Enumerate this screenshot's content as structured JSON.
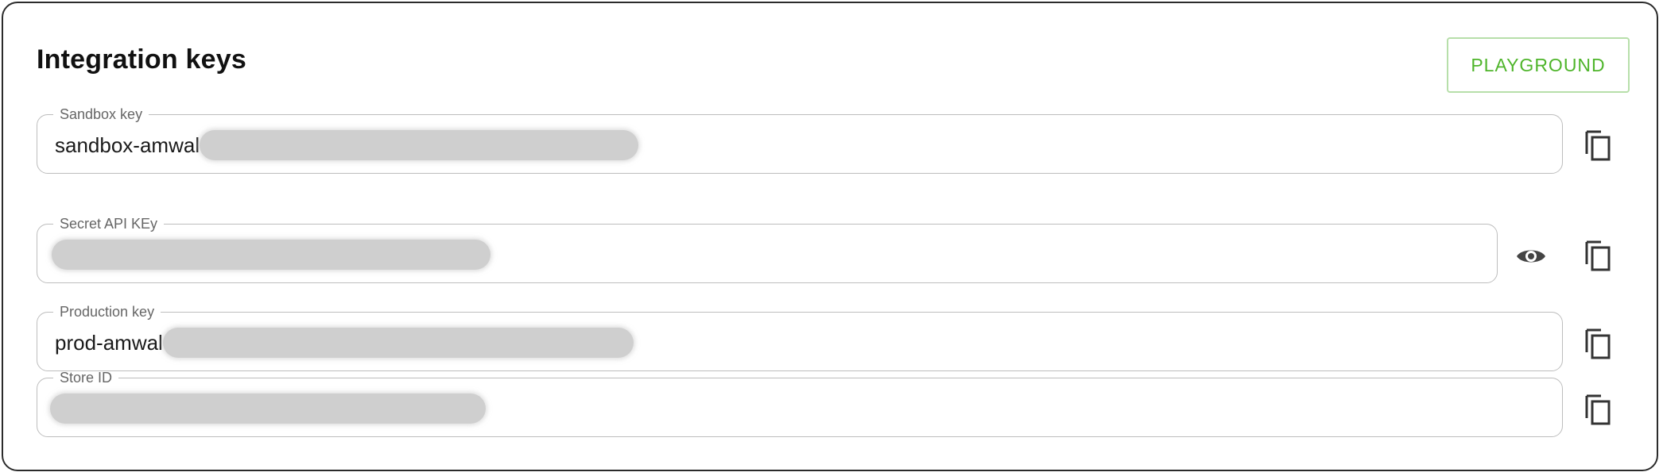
{
  "section": {
    "title": "Integration keys",
    "playground_label": "PLAYGROUND",
    "accent_color": "#4fb52b"
  },
  "fields": {
    "sandbox": {
      "label": "Sandbox key",
      "prefix": "sandbox-amwal",
      "value_masked": true
    },
    "secret": {
      "label": "Secret API KEy",
      "value_masked": true
    },
    "production": {
      "label": "Production key",
      "prefix": "prod-amwal",
      "value_masked": true
    },
    "store": {
      "label": "Store ID",
      "value_masked": true
    }
  },
  "icons": {
    "copy": "copy-icon",
    "reveal": "eye-icon"
  }
}
